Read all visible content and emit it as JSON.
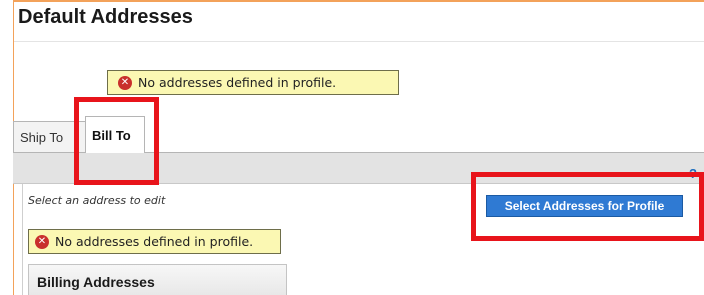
{
  "page": {
    "title": "Default Addresses"
  },
  "alerts": {
    "top": {
      "icon": "error-icon",
      "text": "No addresses defined in profile."
    },
    "bottom": {
      "icon": "error-icon",
      "text": "No addresses defined in profile."
    }
  },
  "tabs": [
    {
      "label": "Ship To",
      "selected": false
    },
    {
      "label": "Bill To",
      "selected": true
    }
  ],
  "panel": {
    "help_label": "?",
    "hint": "Select an address to edit",
    "primary_button_label": "Select Addresses for Profile",
    "section_title": "Billing Addresses"
  },
  "colors": {
    "accent_rule": "#f3a25a",
    "alert_bg": "#fbf8b3",
    "error_icon": "#c9302c",
    "primary_button": "#2f7ad3",
    "highlight": "#e8141b"
  }
}
